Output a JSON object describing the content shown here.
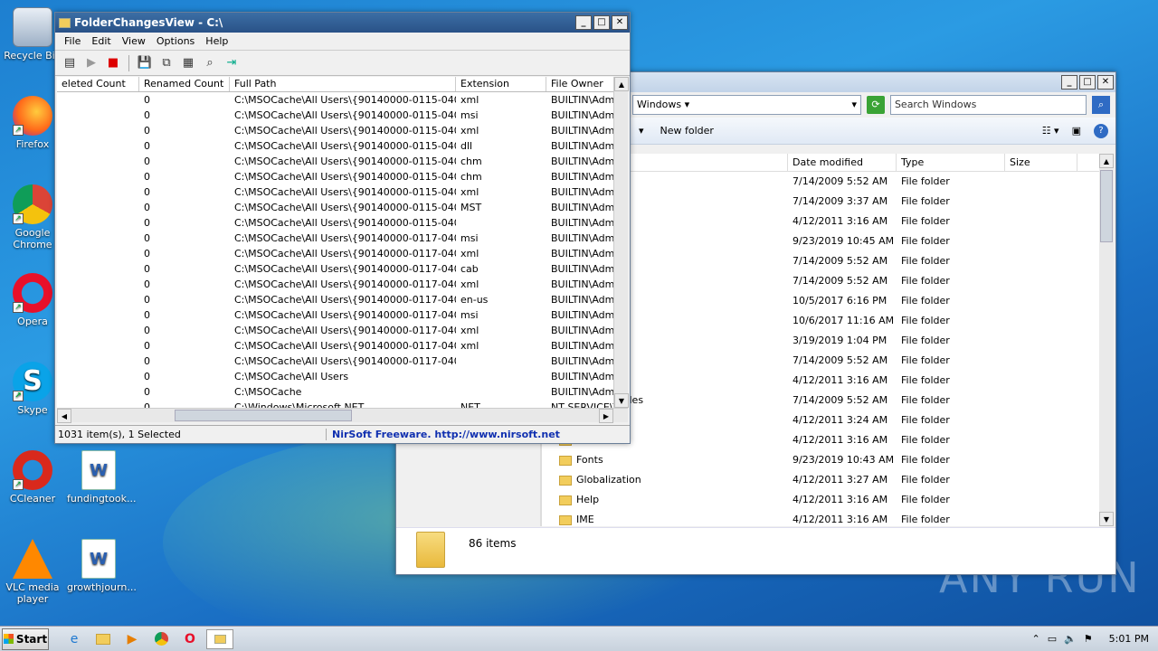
{
  "desktop": {
    "icons": [
      {
        "label": "Recycle Bin",
        "icon": "recycle-bin-icon"
      },
      {
        "label": "Firefox",
        "icon": "firefox-icon"
      },
      {
        "label": "Google Chrome",
        "icon": "chrome-icon"
      },
      {
        "label": "Opera",
        "icon": "opera-icon"
      },
      {
        "label": "Skype",
        "icon": "skype-icon"
      },
      {
        "label": "CCleaner",
        "icon": "ccleaner-icon"
      },
      {
        "label": "fundingtook...",
        "icon": "word-doc-icon"
      },
      {
        "label": "VLC media player",
        "icon": "vlc-icon"
      },
      {
        "label": "growthjourn...",
        "icon": "word-doc-icon"
      }
    ],
    "watermark": "ANY RUN"
  },
  "fcv": {
    "title": "FolderChangesView - C:\\",
    "menu": [
      "File",
      "Edit",
      "View",
      "Options",
      "Help"
    ],
    "columns": [
      "eleted Count",
      "Renamed Count",
      "Full Path",
      "Extension",
      "File Owner"
    ],
    "rows": [
      {
        "deleted": "",
        "renamed": "0",
        "path": "C:\\MSOCache\\All Users\\{90140000-0115-0409....",
        "ext": "xml",
        "owner": "BUILTIN\\Admin"
      },
      {
        "deleted": "",
        "renamed": "0",
        "path": "C:\\MSOCache\\All Users\\{90140000-0115-0409....",
        "ext": "msi",
        "owner": "BUILTIN\\Admin"
      },
      {
        "deleted": "",
        "renamed": "0",
        "path": "C:\\MSOCache\\All Users\\{90140000-0115-0409....",
        "ext": "xml",
        "owner": "BUILTIN\\Admin"
      },
      {
        "deleted": "",
        "renamed": "0",
        "path": "C:\\MSOCache\\All Users\\{90140000-0115-0409....",
        "ext": "dll",
        "owner": "BUILTIN\\Admin"
      },
      {
        "deleted": "",
        "renamed": "0",
        "path": "C:\\MSOCache\\All Users\\{90140000-0115-0409....",
        "ext": "chm",
        "owner": "BUILTIN\\Admin"
      },
      {
        "deleted": "",
        "renamed": "0",
        "path": "C:\\MSOCache\\All Users\\{90140000-0115-0409....",
        "ext": "chm",
        "owner": "BUILTIN\\Admin"
      },
      {
        "deleted": "",
        "renamed": "0",
        "path": "C:\\MSOCache\\All Users\\{90140000-0115-0409....",
        "ext": "xml",
        "owner": "BUILTIN\\Admin"
      },
      {
        "deleted": "",
        "renamed": "0",
        "path": "C:\\MSOCache\\All Users\\{90140000-0115-0409....",
        "ext": "MST",
        "owner": "BUILTIN\\Admin"
      },
      {
        "deleted": "",
        "renamed": "0",
        "path": "C:\\MSOCache\\All Users\\{90140000-0115-0409....",
        "ext": "",
        "owner": "BUILTIN\\Admin"
      },
      {
        "deleted": "",
        "renamed": "0",
        "path": "C:\\MSOCache\\All Users\\{90140000-0117-0409....",
        "ext": "msi",
        "owner": "BUILTIN\\Admin"
      },
      {
        "deleted": "",
        "renamed": "0",
        "path": "C:\\MSOCache\\All Users\\{90140000-0117-0409....",
        "ext": "xml",
        "owner": "BUILTIN\\Admin"
      },
      {
        "deleted": "",
        "renamed": "0",
        "path": "C:\\MSOCache\\All Users\\{90140000-0117-0409....",
        "ext": "cab",
        "owner": "BUILTIN\\Admin"
      },
      {
        "deleted": "",
        "renamed": "0",
        "path": "C:\\MSOCache\\All Users\\{90140000-0117-0409....",
        "ext": "xml",
        "owner": "BUILTIN\\Admin"
      },
      {
        "deleted": "",
        "renamed": "0",
        "path": "C:\\MSOCache\\All Users\\{90140000-0117-0409....",
        "ext": "en-us",
        "owner": "BUILTIN\\Admin"
      },
      {
        "deleted": "",
        "renamed": "0",
        "path": "C:\\MSOCache\\All Users\\{90140000-0117-0409....",
        "ext": "msi",
        "owner": "BUILTIN\\Admin"
      },
      {
        "deleted": "",
        "renamed": "0",
        "path": "C:\\MSOCache\\All Users\\{90140000-0117-0409....",
        "ext": "xml",
        "owner": "BUILTIN\\Admin"
      },
      {
        "deleted": "",
        "renamed": "0",
        "path": "C:\\MSOCache\\All Users\\{90140000-0117-0409....",
        "ext": "xml",
        "owner": "BUILTIN\\Admin"
      },
      {
        "deleted": "",
        "renamed": "0",
        "path": "C:\\MSOCache\\All Users\\{90140000-0117-0409....",
        "ext": "",
        "owner": "BUILTIN\\Admin"
      },
      {
        "deleted": "",
        "renamed": "0",
        "path": "C:\\MSOCache\\All Users",
        "ext": "",
        "owner": "BUILTIN\\Admin"
      },
      {
        "deleted": "",
        "renamed": "0",
        "path": "C:\\MSOCache",
        "ext": "",
        "owner": "BUILTIN\\Admin"
      },
      {
        "deleted": "",
        "renamed": "0",
        "path": "C:\\Windows\\Microsoft.NET",
        "ext": "NET",
        "owner": "NT SERVICE\\T"
      }
    ],
    "status_count": "1031 item(s), 1 Selected",
    "status_link": "NirSoft Freeware.  http://www.nirsoft.net"
  },
  "explorer": {
    "breadcrumb": "Windows",
    "search_placeholder": "Search Windows",
    "new_folder": "New folder",
    "columns": [
      "Date modified",
      "Type",
      "Size"
    ],
    "rows": [
      {
        "name": "",
        "date": "7/14/2009 5:52 AM",
        "type": "File folder"
      },
      {
        "name": "",
        "date": "7/14/2009 3:37 AM",
        "type": "File folder"
      },
      {
        "name": "",
        "date": "4/12/2011 3:16 AM",
        "type": "File folder"
      },
      {
        "name": "",
        "date": "9/23/2019 10:45 AM",
        "type": "File folder"
      },
      {
        "name": "",
        "date": "7/14/2009 5:52 AM",
        "type": "File folder"
      },
      {
        "name": "",
        "date": "7/14/2009 5:52 AM",
        "type": "File folder"
      },
      {
        "name": "",
        "date": "10/5/2017 6:16 PM",
        "type": "File folder"
      },
      {
        "name": "",
        "date": "10/6/2017 11:16 AM",
        "type": "File folder"
      },
      {
        "name": "",
        "date": "3/19/2019 1:04 PM",
        "type": "File folder"
      },
      {
        "name": "",
        "date": "7/14/2009 5:52 AM",
        "type": "File folder"
      },
      {
        "name": "",
        "date": "4/12/2011 3:16 AM",
        "type": "File folder"
      },
      {
        "name": "Program Files",
        "date": "7/14/2009 5:52 AM",
        "type": "File folder"
      },
      {
        "name": "",
        "date": "4/12/2011 3:24 AM",
        "type": "File folder"
      },
      {
        "name": "en-US",
        "date": "4/12/2011 3:16 AM",
        "type": "File folder"
      },
      {
        "name": "Fonts",
        "date": "9/23/2019 10:43 AM",
        "type": "File folder"
      },
      {
        "name": "Globalization",
        "date": "4/12/2011 3:27 AM",
        "type": "File folder"
      },
      {
        "name": "Help",
        "date": "4/12/2011 3:16 AM",
        "type": "File folder"
      },
      {
        "name": "IME",
        "date": "4/12/2011 3:16 AM",
        "type": "File folder"
      }
    ],
    "details": "86 items"
  },
  "taskbar": {
    "start": "Start",
    "clock": "5:01 PM"
  }
}
